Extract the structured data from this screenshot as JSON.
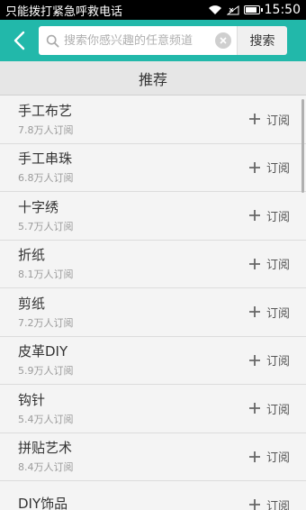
{
  "status_bar": {
    "carrier_text": "只能拨打紧急呼救电话",
    "time": "15:50",
    "icons": [
      "wifi-icon",
      "no-signal-icon",
      "battery-icon"
    ]
  },
  "header": {
    "search_placeholder": "搜索你感兴趣的任意频道",
    "search_button_label": "搜索",
    "accent_color": "#22b8aa"
  },
  "section": {
    "title": "推荐"
  },
  "channels": [
    {
      "name": "手工布艺",
      "subscribers": "7.8万人订阅",
      "action_label": "订阅"
    },
    {
      "name": "手工串珠",
      "subscribers": "6.8万人订阅",
      "action_label": "订阅"
    },
    {
      "name": "十字绣",
      "subscribers": "5.7万人订阅",
      "action_label": "订阅"
    },
    {
      "name": "折纸",
      "subscribers": "8.1万人订阅",
      "action_label": "订阅"
    },
    {
      "name": "剪纸",
      "subscribers": "7.2万人订阅",
      "action_label": "订阅"
    },
    {
      "name": "皮革DIY",
      "subscribers": "5.9万人订阅",
      "action_label": "订阅"
    },
    {
      "name": "钩针",
      "subscribers": "5.4万人订阅",
      "action_label": "订阅"
    },
    {
      "name": "拼贴艺术",
      "subscribers": "8.4万人订阅",
      "action_label": "订阅"
    },
    {
      "name": "DIY饰品",
      "subscribers": "",
      "action_label": "订阅"
    }
  ]
}
